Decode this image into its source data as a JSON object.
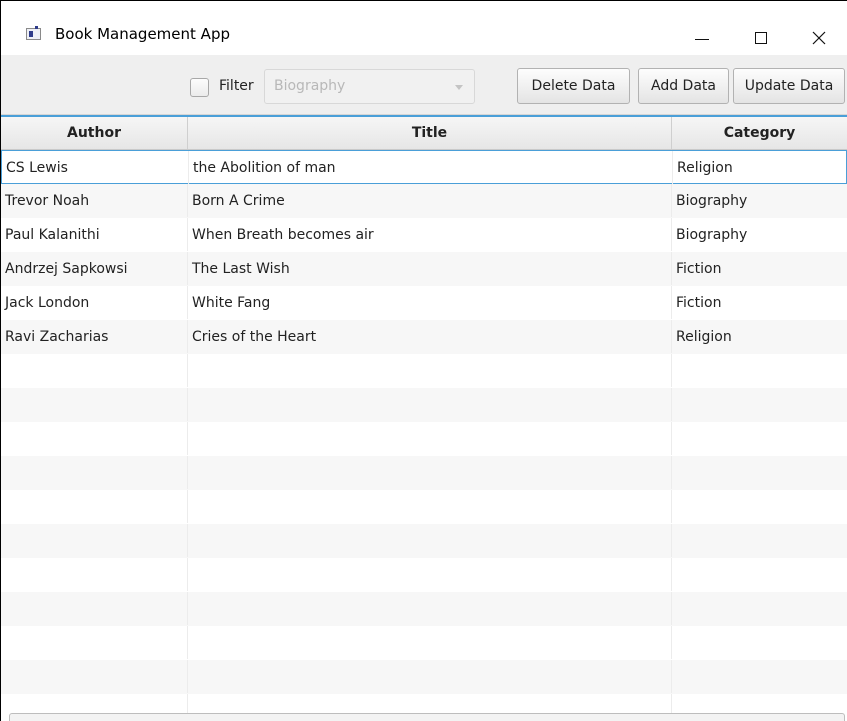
{
  "window": {
    "title": "Book Management App"
  },
  "toolbar": {
    "filter_label": "Filter",
    "filter_checked": false,
    "category_select_value": "Biography",
    "delete_label": "Delete Data",
    "add_label": "Add Data",
    "update_label": "Update Data"
  },
  "table": {
    "columns": [
      "Author",
      "Title",
      "Category"
    ],
    "rows": [
      {
        "author": "CS Lewis",
        "title": "the Abolition of man",
        "category": "Religion"
      },
      {
        "author": "Trevor Noah",
        "title": "Born A Crime",
        "category": "Biography"
      },
      {
        "author": "Paul Kalanithi",
        "title": "When Breath becomes air",
        "category": "Biography"
      },
      {
        "author": "Andrzej Sapkowsi",
        "title": "The Last Wish",
        "category": "Fiction"
      },
      {
        "author": "Jack London",
        "title": "White Fang",
        "category": "Fiction"
      },
      {
        "author": "Ravi Zacharias",
        "title": "Cries of the Heart",
        "category": "Religion"
      }
    ],
    "selected_row": 0
  },
  "colors": {
    "accent": "#4a9fd8",
    "toolbar_bg": "#efefef",
    "row_alt": "#f7f7f7"
  }
}
